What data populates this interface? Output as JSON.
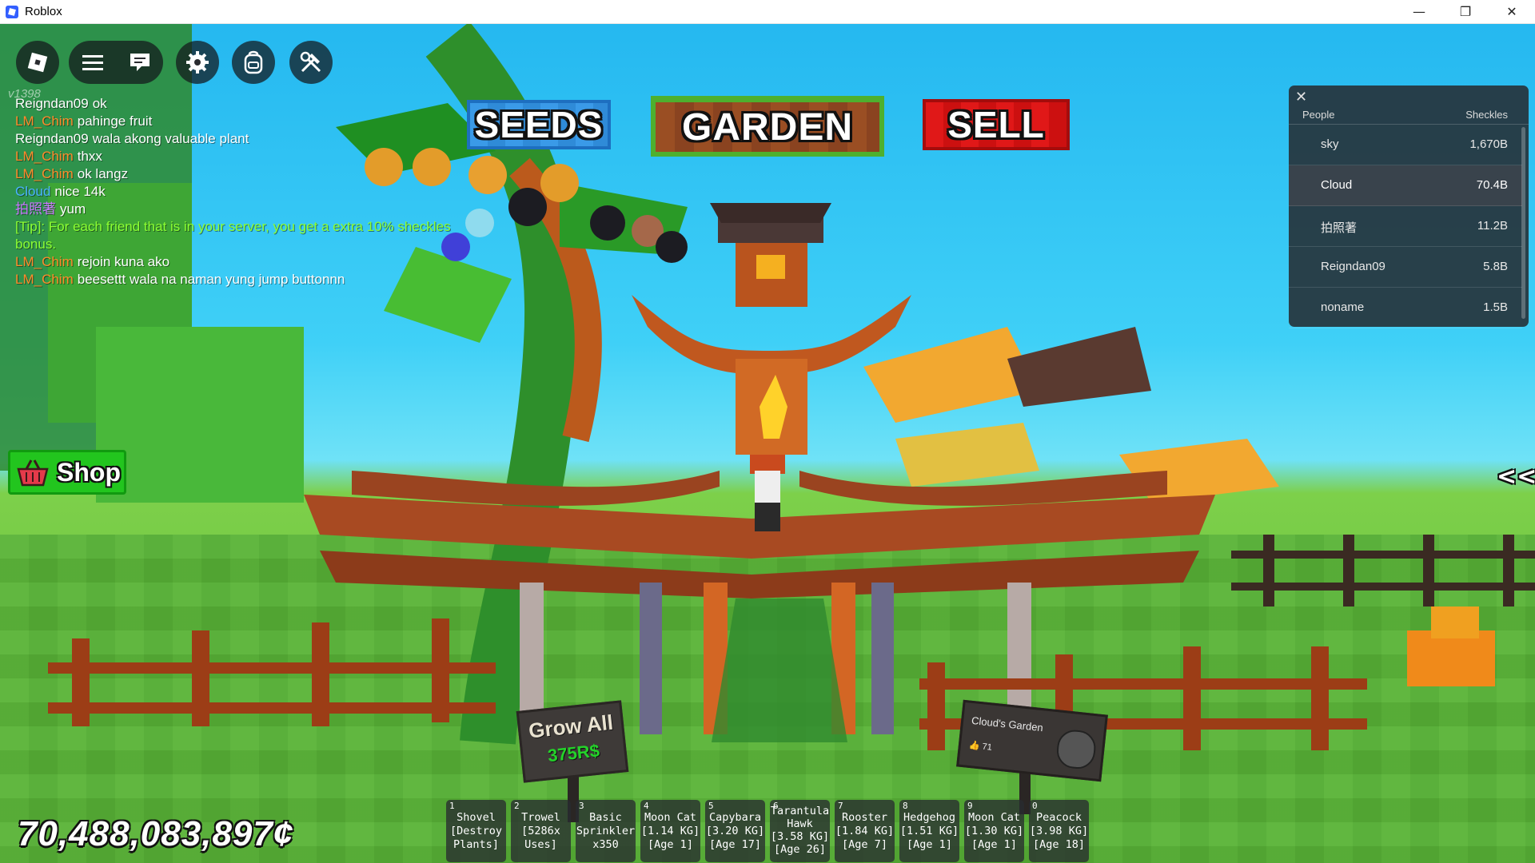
{
  "window": {
    "title": "Roblox",
    "controls": {
      "minimize": "—",
      "maximize": "❐",
      "close": "✕"
    }
  },
  "hud": {
    "version": "v1398",
    "top_buttons": {
      "seeds": "SEEDS",
      "garden": "GARDEN",
      "sell": "SELL"
    },
    "shop_label": "Shop",
    "collapse_label": "<<",
    "money": "70,488,083,897¢"
  },
  "chat": [
    {
      "name": "Reigndan09",
      "name_color": "#ffffff",
      "text": "ok"
    },
    {
      "name": "LM_Chim",
      "name_color": "#ff8b2c",
      "text": "pahinge fruit"
    },
    {
      "name": "Reigndan09",
      "name_color": "#ffffff",
      "text": "wala akong valuable plant"
    },
    {
      "name": "LM_Chim",
      "name_color": "#ff8b2c",
      "text": "thxx"
    },
    {
      "name": "LM_Chim",
      "name_color": "#ff8b2c",
      "text": "ok langz"
    },
    {
      "name": "Cloud",
      "name_color": "#4ab3ff",
      "text": "nice 14k"
    },
    {
      "name": "拍照著",
      "name_color": "#c97bff",
      "text": "yum"
    },
    {
      "name": "",
      "name_color": "#8cff33",
      "text": "[Tip]: For each friend that is in your server, you get a extra 10% sheckles bonus.",
      "tip": true
    },
    {
      "name": "LM_Chim",
      "name_color": "#ff8b2c",
      "text": "rejoin kuna ako"
    },
    {
      "name": "LM_Chim",
      "name_color": "#ff8b2c",
      "text": "beesettt wala na naman yung jump buttonnn"
    }
  ],
  "leaderboard": {
    "close": "✕",
    "header_people": "People",
    "header_stat": "Sheckles",
    "rows": [
      {
        "name": "sky",
        "value": "1,670B"
      },
      {
        "name": "Cloud",
        "value": "70.4B"
      },
      {
        "name": "拍照著",
        "value": "11.2B"
      },
      {
        "name": "Reigndan09",
        "value": "5.8B"
      },
      {
        "name": "noname",
        "value": "1.5B"
      }
    ]
  },
  "hotbar": [
    {
      "num": "1",
      "label": "Shovel\n[Destroy\nPlants]"
    },
    {
      "num": "2",
      "label": "Trowel\n[5286x\nUses]"
    },
    {
      "num": "3",
      "label": "Basic\nSprinkler\nx350"
    },
    {
      "num": "4",
      "label": "Moon Cat\n[1.14 KG]\n[Age 1]"
    },
    {
      "num": "5",
      "label": "Capybara\n[3.20 KG]\n[Age 17]"
    },
    {
      "num": "6",
      "label": "Tarantula\nHawk\n[3.58 KG]\n[Age 26]"
    },
    {
      "num": "7",
      "label": "Rooster\n[1.84 KG]\n[Age 7]"
    },
    {
      "num": "8",
      "label": "Hedgehog\n[1.51 KG]\n[Age 1]"
    },
    {
      "num": "9",
      "label": "Moon Cat\n[1.30 KG]\n[Age 1]"
    },
    {
      "num": "0",
      "label": "Peacock\n[3.98 KG]\n[Age 18]"
    }
  ],
  "world": {
    "grow_all_title": "Grow All",
    "grow_all_price": "375R$",
    "garden_sign_title": "Cloud's Garden",
    "garden_sign_likes": "👍 71"
  },
  "colors": {
    "sky": "#2fc3f3",
    "grass": "#5cb53a",
    "seeds": "#2f8bd8",
    "garden": "#8a4320",
    "sell": "#e01818",
    "shop": "#22c51e",
    "tip": "#8cff33"
  }
}
